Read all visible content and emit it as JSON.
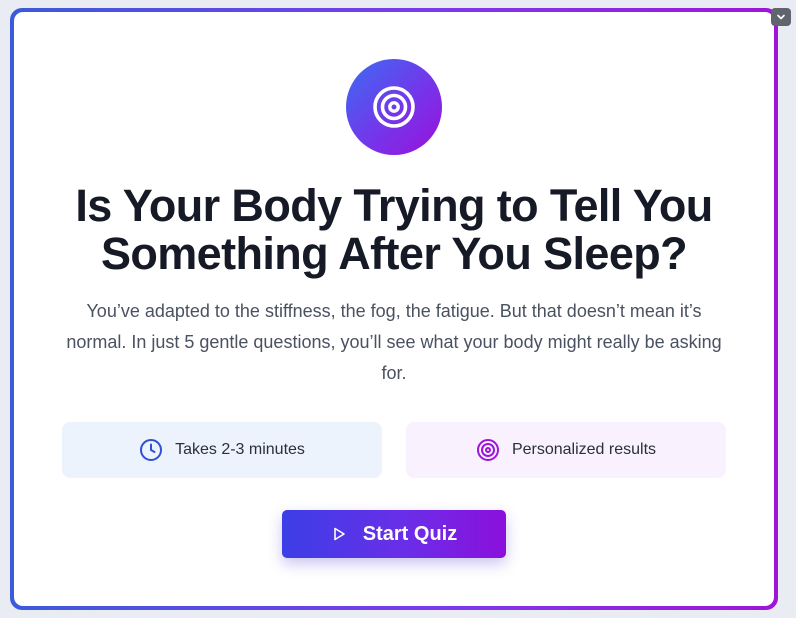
{
  "hero": {
    "icon": "target-icon",
    "title": "Is Your Body Trying to Tell You Something After You Sleep?",
    "subtitle": "You’ve adapted to the stiffness, the fog, the fatigue. But that doesn’t mean it’s normal. In just 5 gentle questions, you’ll see what your body might really be asking for."
  },
  "features": [
    {
      "icon": "clock-icon",
      "label": "Takes 2-3 minutes",
      "color": "#2f4fd6"
    },
    {
      "icon": "target-icon",
      "label": "Personalized results",
      "color": "#9d16d8"
    }
  ],
  "cta": {
    "icon": "play-icon",
    "label": "Start Quiz"
  },
  "corner": {
    "icon": "chevron-down-icon"
  },
  "colors": {
    "gradient_start": "#3b5bdb",
    "gradient_end": "#9d16d8",
    "title": "#161a26",
    "body_text": "#4a5161"
  }
}
